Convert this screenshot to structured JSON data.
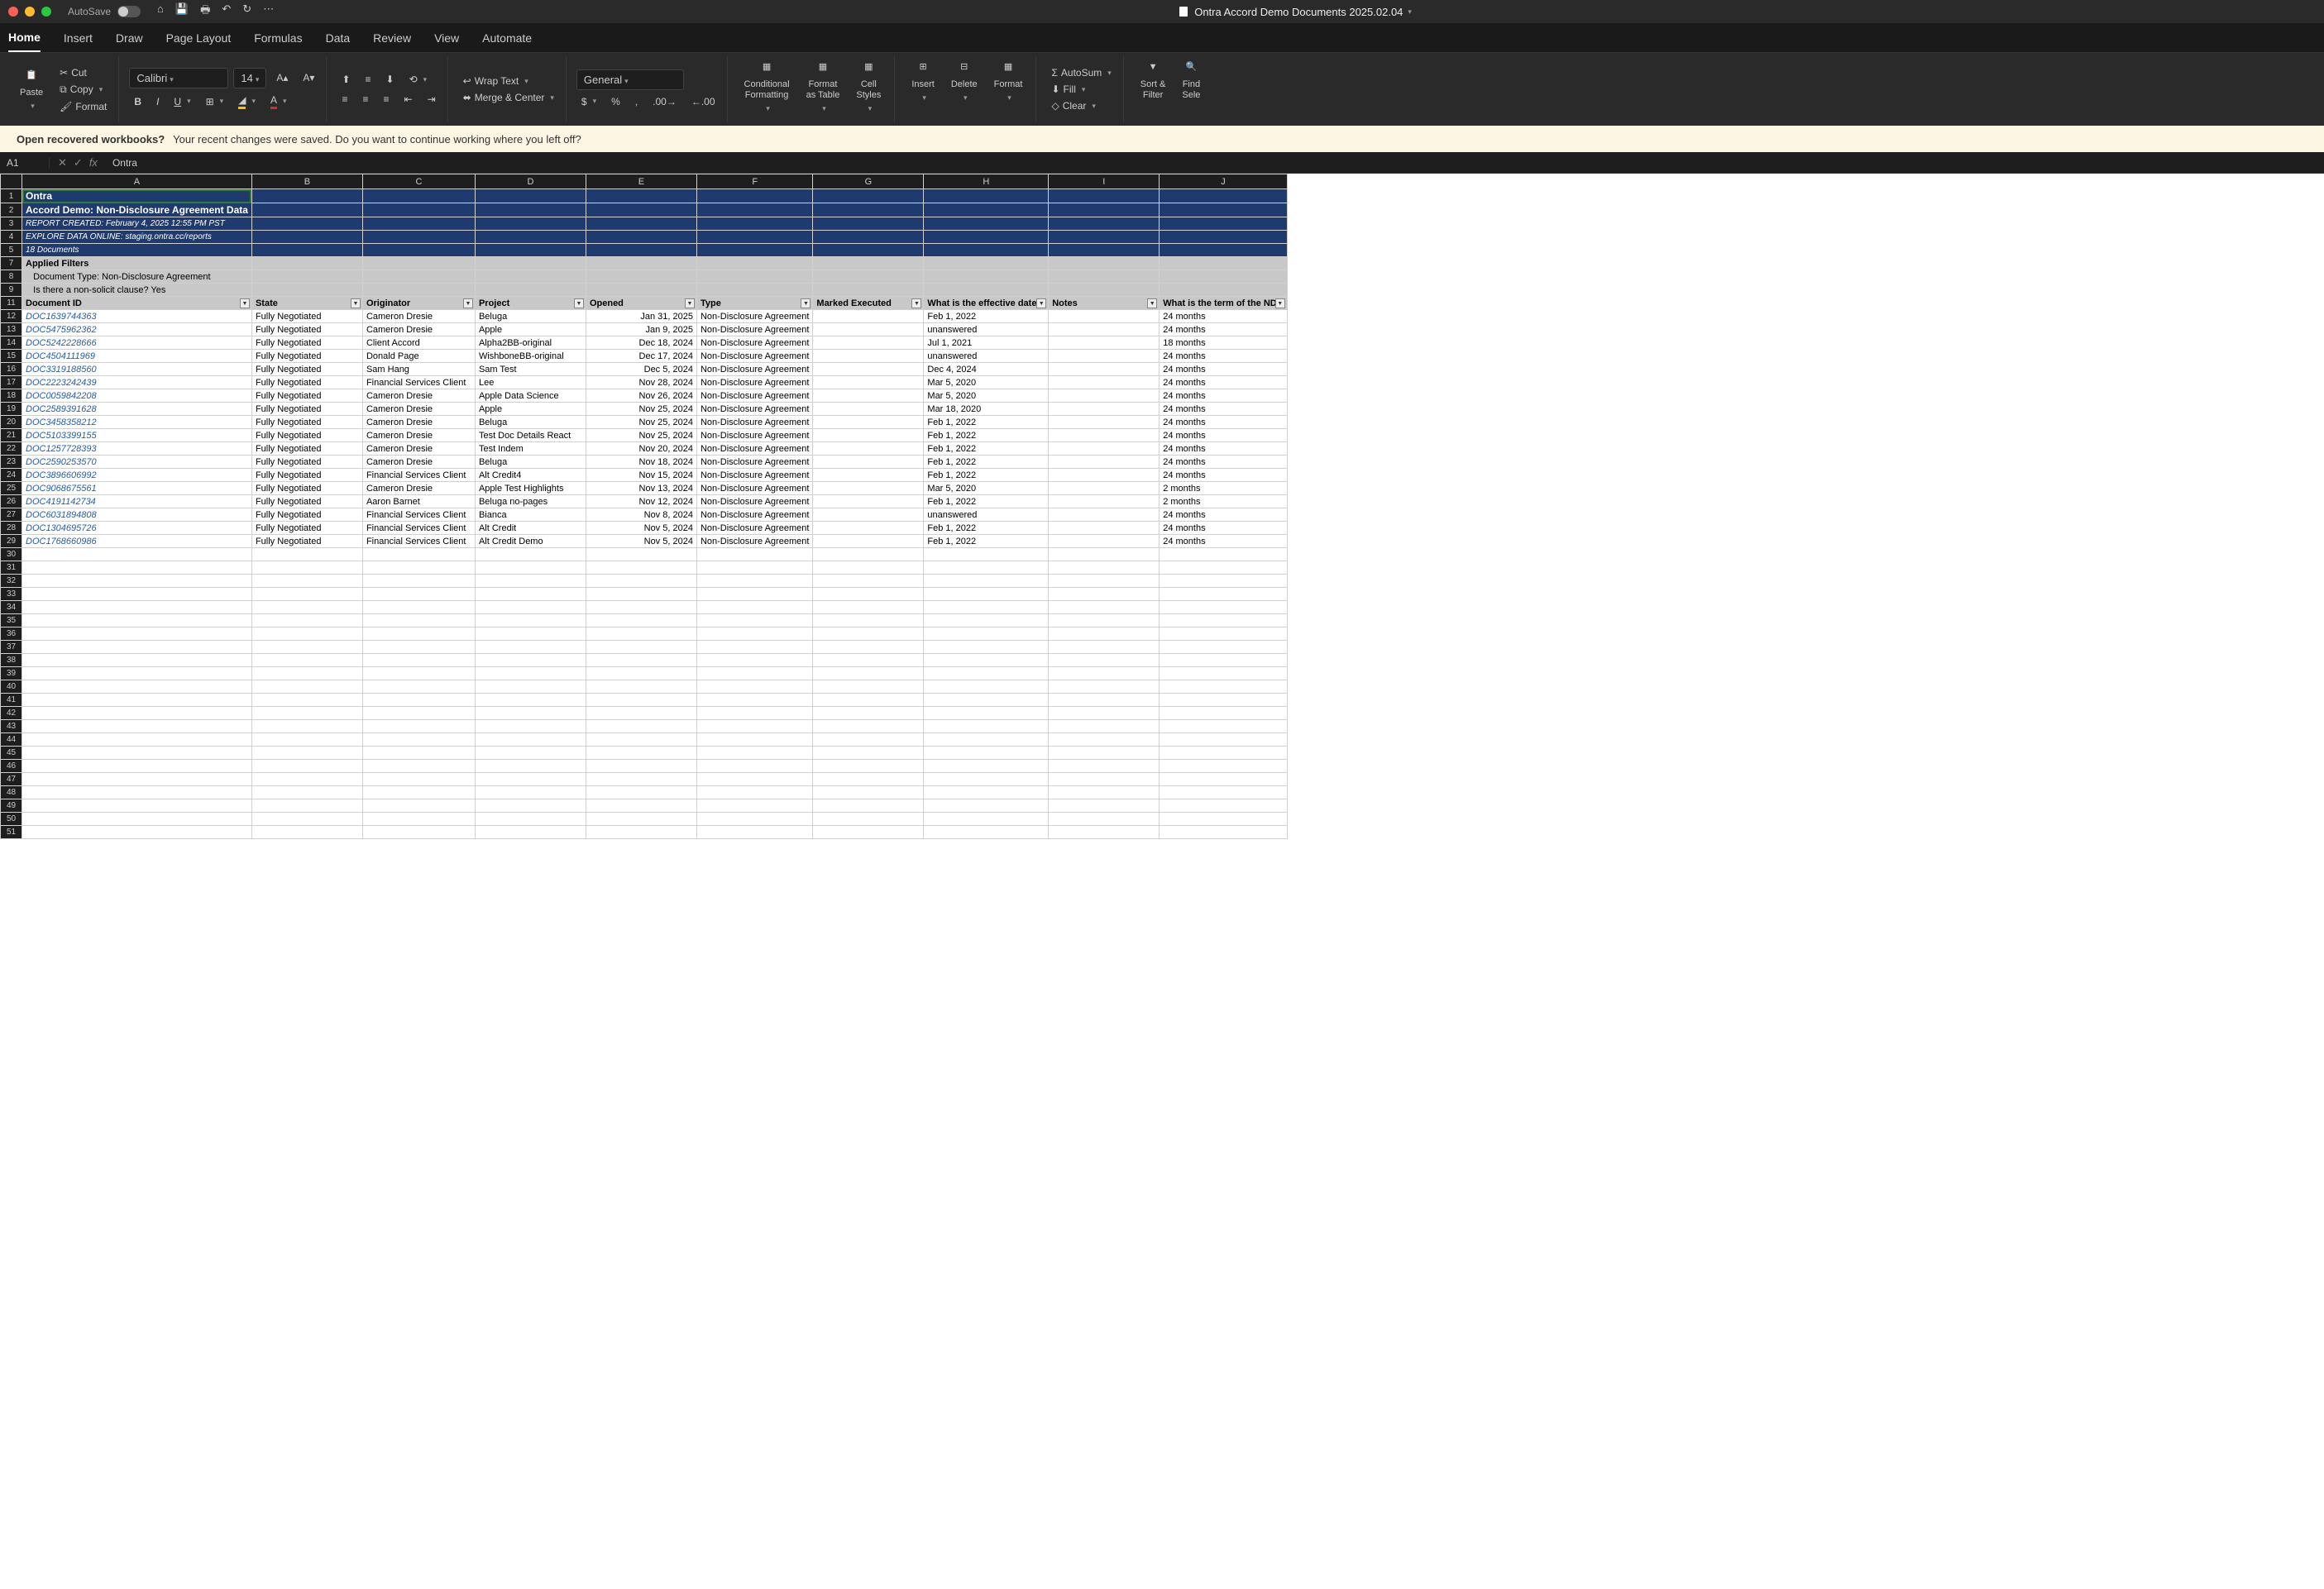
{
  "titlebar": {
    "autosave": "AutoSave",
    "doc_title": "Ontra Accord Demo Documents 2025.02.04"
  },
  "tabs": [
    "Home",
    "Insert",
    "Draw",
    "Page Layout",
    "Formulas",
    "Data",
    "Review",
    "View",
    "Automate"
  ],
  "ribbon": {
    "paste": "Paste",
    "cut": "Cut",
    "copy": "Copy",
    "format_painter": "Format",
    "font_name": "Calibri",
    "font_size": "14",
    "bold": "B",
    "italic": "I",
    "underline": "U",
    "wrap": "Wrap Text",
    "merge": "Merge & Center",
    "number_format": "General",
    "cond_fmt": "Conditional\nFormatting",
    "fmt_table": "Format\nas Table",
    "cell_styles": "Cell\nStyles",
    "insert": "Insert",
    "delete": "Delete",
    "format": "Format",
    "autosum": "AutoSum",
    "fill": "Fill",
    "clear": "Clear",
    "sort_filter": "Sort &\nFilter",
    "find": "Find\nSele"
  },
  "msgbar": {
    "title": "Open recovered workbooks?",
    "text": "Your recent changes were saved. Do you want to continue working where you left off?"
  },
  "fbar": {
    "cell_ref": "A1",
    "formula": "Ontra"
  },
  "columns": [
    "A",
    "B",
    "C",
    "D",
    "E",
    "F",
    "G",
    "H",
    "I",
    "J"
  ],
  "header_rows": {
    "r1": "Ontra",
    "r2": "Accord Demo: Non-Disclosure Agreement Data",
    "r3": "REPORT CREATED: February 4, 2025 12:55 PM PST",
    "r4": "EXPLORE DATA ONLINE: staging.ontra.cc/reports",
    "r5": "18 Documents",
    "r7": "Applied Filters",
    "r8": "Document Type: Non-Disclosure Agreement",
    "r9": "Is there a non-solicit clause? Yes"
  },
  "table_headers": [
    "Document ID",
    "State",
    "Originator",
    "Project",
    "Opened",
    "Type",
    "Marked Executed",
    "What is the effective date o",
    "Notes",
    "What is the term of the NDA"
  ],
  "rows": [
    {
      "id": "DOC1639744363",
      "state": "Fully Negotiated",
      "orig": "Cameron Dresie",
      "proj": "Beluga",
      "opened": "Jan 31, 2025",
      "type": "Non-Disclosure Agreement",
      "exec": "",
      "eff": "Feb 1, 2022",
      "notes": "",
      "term": "24 months"
    },
    {
      "id": "DOC5475962362",
      "state": "Fully Negotiated",
      "orig": "Cameron Dresie",
      "proj": "Apple",
      "opened": "Jan 9, 2025",
      "type": "Non-Disclosure Agreement",
      "exec": "",
      "eff": "unanswered",
      "notes": "",
      "term": "24 months"
    },
    {
      "id": "DOC5242228666",
      "state": "Fully Negotiated",
      "orig": "Client Accord",
      "proj": "Alpha2BB-original",
      "opened": "Dec 18, 2024",
      "type": "Non-Disclosure Agreement",
      "exec": "",
      "eff": "Jul 1, 2021",
      "notes": "",
      "term": "18 months"
    },
    {
      "id": "DOC4504111969",
      "state": "Fully Negotiated",
      "orig": "Donald Page",
      "proj": "WishboneBB-original",
      "opened": "Dec 17, 2024",
      "type": "Non-Disclosure Agreement",
      "exec": "",
      "eff": "unanswered",
      "notes": "",
      "term": "24 months"
    },
    {
      "id": "DOC3319188560",
      "state": "Fully Negotiated",
      "orig": "Sam Hang",
      "proj": "Sam Test",
      "opened": "Dec 5, 2024",
      "type": "Non-Disclosure Agreement",
      "exec": "",
      "eff": "Dec 4, 2024",
      "notes": "",
      "term": "24 months"
    },
    {
      "id": "DOC2223242439",
      "state": "Fully Negotiated",
      "orig": "Financial Services Client",
      "proj": "Lee",
      "opened": "Nov 28, 2024",
      "type": "Non-Disclosure Agreement",
      "exec": "",
      "eff": "Mar 5, 2020",
      "notes": "",
      "term": "24 months"
    },
    {
      "id": "DOC0059842208",
      "state": "Fully Negotiated",
      "orig": "Cameron Dresie",
      "proj": "Apple Data Science",
      "opened": "Nov 26, 2024",
      "type": "Non-Disclosure Agreement",
      "exec": "",
      "eff": "Mar 5, 2020",
      "notes": "",
      "term": "24 months"
    },
    {
      "id": "DOC2589391628",
      "state": "Fully Negotiated",
      "orig": "Cameron Dresie",
      "proj": "Apple",
      "opened": "Nov 25, 2024",
      "type": "Non-Disclosure Agreement",
      "exec": "",
      "eff": "Mar 18, 2020",
      "notes": "",
      "term": "24 months"
    },
    {
      "id": "DOC3458358212",
      "state": "Fully Negotiated",
      "orig": "Cameron Dresie",
      "proj": "Beluga",
      "opened": "Nov 25, 2024",
      "type": "Non-Disclosure Agreement",
      "exec": "",
      "eff": "Feb 1, 2022",
      "notes": "",
      "term": "24 months"
    },
    {
      "id": "DOC5103399155",
      "state": "Fully Negotiated",
      "orig": "Cameron Dresie",
      "proj": "Test Doc Details React",
      "opened": "Nov 25, 2024",
      "type": "Non-Disclosure Agreement",
      "exec": "",
      "eff": "Feb 1, 2022",
      "notes": "",
      "term": "24 months"
    },
    {
      "id": "DOC1257728393",
      "state": "Fully Negotiated",
      "orig": "Cameron Dresie",
      "proj": "Test Indem",
      "opened": "Nov 20, 2024",
      "type": "Non-Disclosure Agreement",
      "exec": "",
      "eff": "Feb 1, 2022",
      "notes": "",
      "term": "24 months"
    },
    {
      "id": "DOC2590253570",
      "state": "Fully Negotiated",
      "orig": "Cameron Dresie",
      "proj": "Beluga",
      "opened": "Nov 18, 2024",
      "type": "Non-Disclosure Agreement",
      "exec": "",
      "eff": "Feb 1, 2022",
      "notes": "",
      "term": "24 months"
    },
    {
      "id": "DOC3896606992",
      "state": "Fully Negotiated",
      "orig": "Financial Services Client",
      "proj": "Alt Credit4",
      "opened": "Nov 15, 2024",
      "type": "Non-Disclosure Agreement",
      "exec": "",
      "eff": "Feb 1, 2022",
      "notes": "",
      "term": "24 months"
    },
    {
      "id": "DOC9068675561",
      "state": "Fully Negotiated",
      "orig": "Cameron Dresie",
      "proj": "Apple Test Highlights",
      "opened": "Nov 13, 2024",
      "type": "Non-Disclosure Agreement",
      "exec": "",
      "eff": "Mar 5, 2020",
      "notes": "",
      "term": "2 months"
    },
    {
      "id": "DOC4191142734",
      "state": "Fully Negotiated",
      "orig": "Aaron Barnet",
      "proj": "Beluga no-pages",
      "opened": "Nov 12, 2024",
      "type": "Non-Disclosure Agreement",
      "exec": "",
      "eff": "Feb 1, 2022",
      "notes": "",
      "term": "2 months"
    },
    {
      "id": "DOC6031894808",
      "state": "Fully Negotiated",
      "orig": "Financial Services Client",
      "proj": "Bianca",
      "opened": "Nov 8, 2024",
      "type": "Non-Disclosure Agreement",
      "exec": "",
      "eff": "unanswered",
      "notes": "",
      "term": "24 months"
    },
    {
      "id": "DOC1304695726",
      "state": "Fully Negotiated",
      "orig": "Financial Services Client",
      "proj": "Alt Credit",
      "opened": "Nov 5, 2024",
      "type": "Non-Disclosure Agreement",
      "exec": "",
      "eff": "Feb 1, 2022",
      "notes": "",
      "term": "24 months"
    },
    {
      "id": "DOC1768660986",
      "state": "Fully Negotiated",
      "orig": "Financial Services Client",
      "proj": "Alt Credit Demo",
      "opened": "Nov 5, 2024",
      "type": "Non-Disclosure Agreement",
      "exec": "",
      "eff": "Feb 1, 2022",
      "notes": "",
      "term": "24 months"
    }
  ]
}
